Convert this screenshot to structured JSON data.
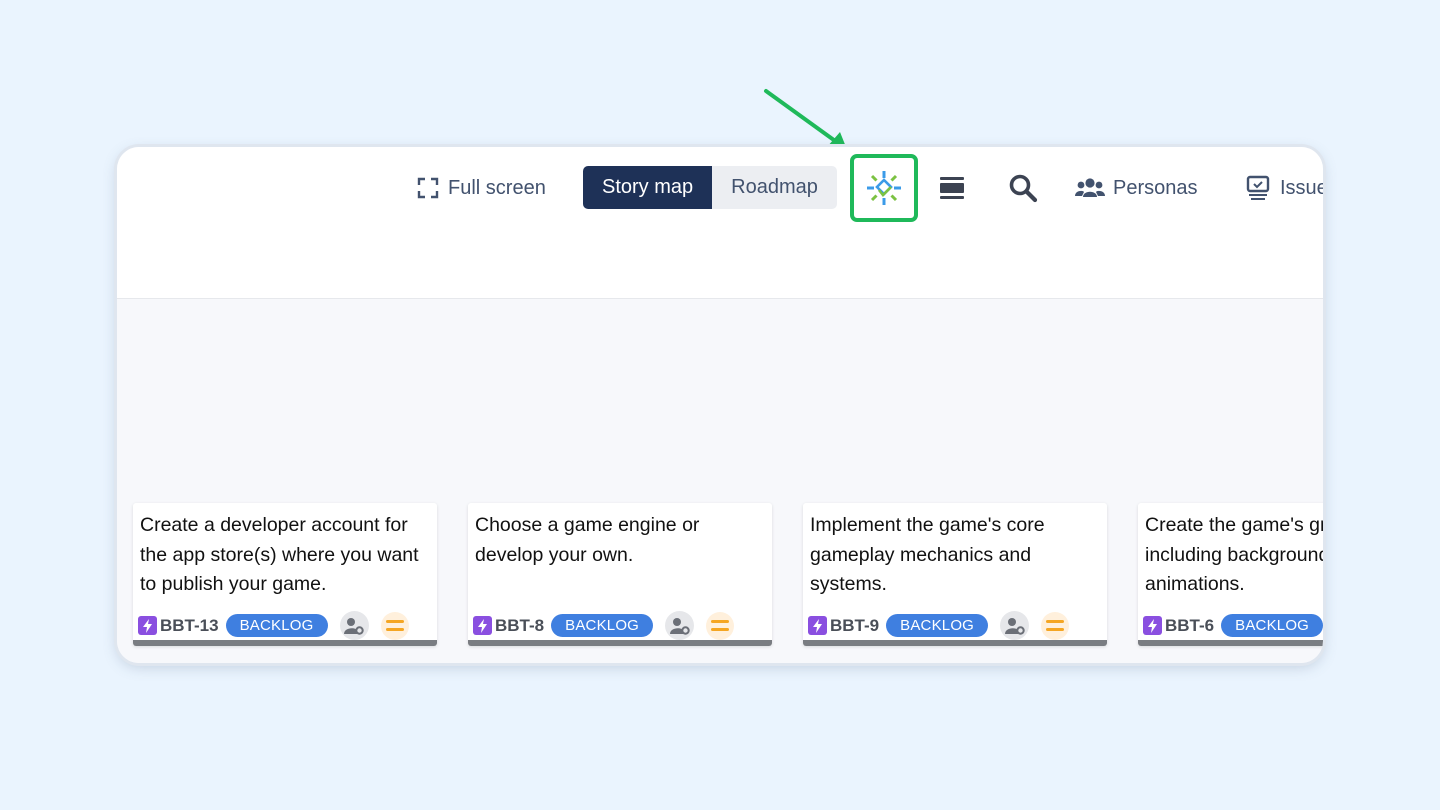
{
  "toolbar": {
    "fullscreen_label": "Full screen",
    "view_toggle": {
      "options": [
        "Story map",
        "Roadmap"
      ],
      "selected": "Story map"
    },
    "highlighted_icon": "integration-spark-icon",
    "highlight_color": "#1fb95a",
    "personas_label": "Personas",
    "issues_label": "Issue"
  },
  "cards": [
    {
      "title": "Create a developer account for the app store(s) where you want to publish your game.",
      "key": "BBT-13",
      "status": "BACKLOG",
      "type": "epic-lightning",
      "priority": "medium"
    },
    {
      "title": "Choose a game engine or develop your own.",
      "key": "BBT-8",
      "status": "BACKLOG",
      "type": "epic-lightning",
      "priority": "medium"
    },
    {
      "title": "Implement the game's core gameplay mechanics and systems.",
      "key": "BBT-9",
      "status": "BACKLOG",
      "type": "epic-lightning",
      "priority": "medium"
    },
    {
      "title": "Create the game's graphics, including backgrounds and animations.",
      "key": "BBT-6",
      "status": "BACKLOG",
      "type": "epic-lightning",
      "priority": "medium"
    }
  ],
  "colors": {
    "background": "#eaf4fe",
    "active_toggle": "#1e3157",
    "status_badge": "#3f7fe0",
    "epic_icon": "#8a4fe0",
    "priority": "#f5a623",
    "annotation_arrow": "#1fb95a"
  }
}
